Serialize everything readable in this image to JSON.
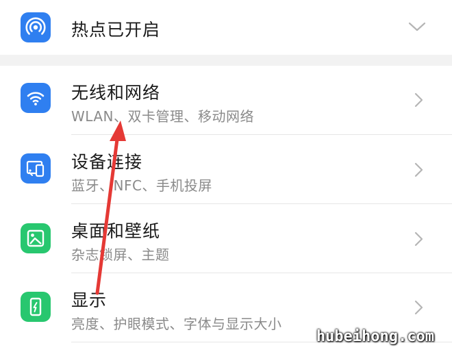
{
  "colors": {
    "blue_accent": "#2f7ff0",
    "green_accent": "#28c76f",
    "annotation_arrow": "#e53935",
    "title_text": "#1a1a1a",
    "subtitle_text": "#8a8a8a"
  },
  "hotspot": {
    "label": "热点已开启",
    "icon": "hotspot-icon",
    "expand_icon": "chevron-down-icon"
  },
  "settings": {
    "items": [
      {
        "title": "无线和网络",
        "subtitle": "WLAN、双卡管理、移动网络",
        "icon": "wifi-icon"
      },
      {
        "title": "设备连接",
        "subtitle": "蓝牙、NFC、手机投屏",
        "icon": "device-connection-icon"
      },
      {
        "title": "桌面和壁纸",
        "subtitle": "杂志锁屏、主题",
        "icon": "wallpaper-icon"
      },
      {
        "title": "显示",
        "subtitle": "亮度、护眼模式、字体与显示大小",
        "icon": "display-icon"
      }
    ]
  },
  "watermark": {
    "text": "hubeihong.com"
  }
}
